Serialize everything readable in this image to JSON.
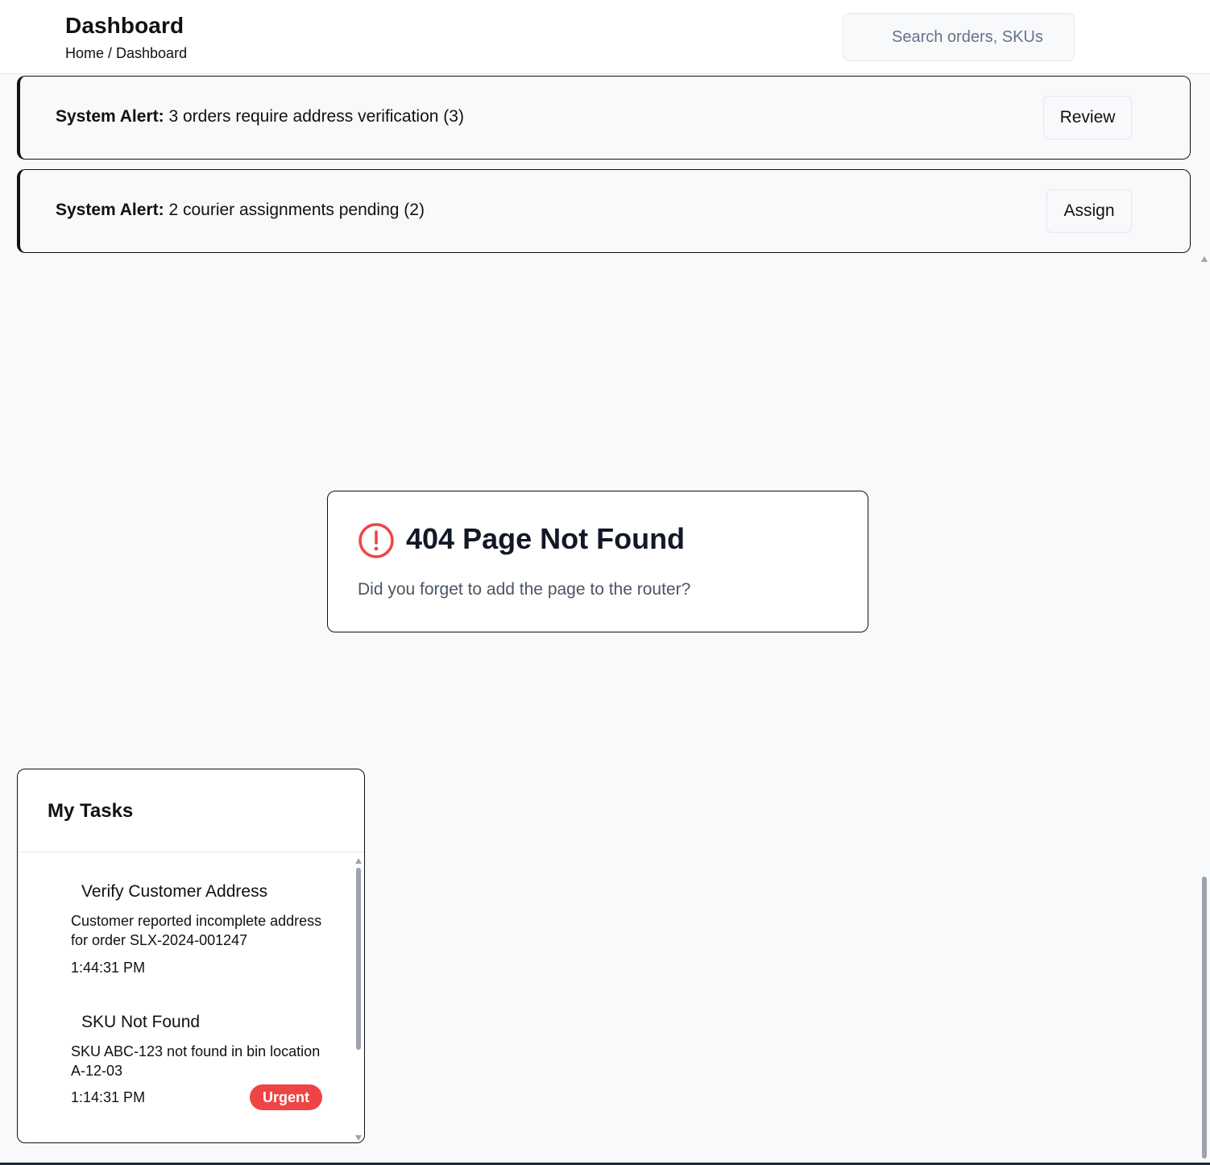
{
  "header": {
    "title": "Dashboard",
    "breadcrumb": "Home / Dashboard",
    "search_placeholder": "Search orders, SKUs"
  },
  "alerts": [
    {
      "prefix": "System Alert:",
      "message": "3 orders require address verification (3)",
      "action_label": "Review"
    },
    {
      "prefix": "System Alert:",
      "message": "2 courier assignments pending (2)",
      "action_label": "Assign"
    }
  ],
  "error_card": {
    "icon": "alert-circle-icon",
    "title": "404 Page Not Found",
    "message": "Did you forget to add the page to the router?",
    "icon_color": "#ef4444"
  },
  "tasks": {
    "title": "My Tasks",
    "items": [
      {
        "title": "Verify Customer Address",
        "description": "Customer reported incomplete address for order SLX-2024-001247",
        "time": "1:44:31 PM"
      },
      {
        "title": "SKU Not Found",
        "description": "SKU ABC-123 not found in bin location A-12-03",
        "time": "1:14:31 PM",
        "badge": "Urgent",
        "badge_color": "#ef4444"
      }
    ]
  }
}
